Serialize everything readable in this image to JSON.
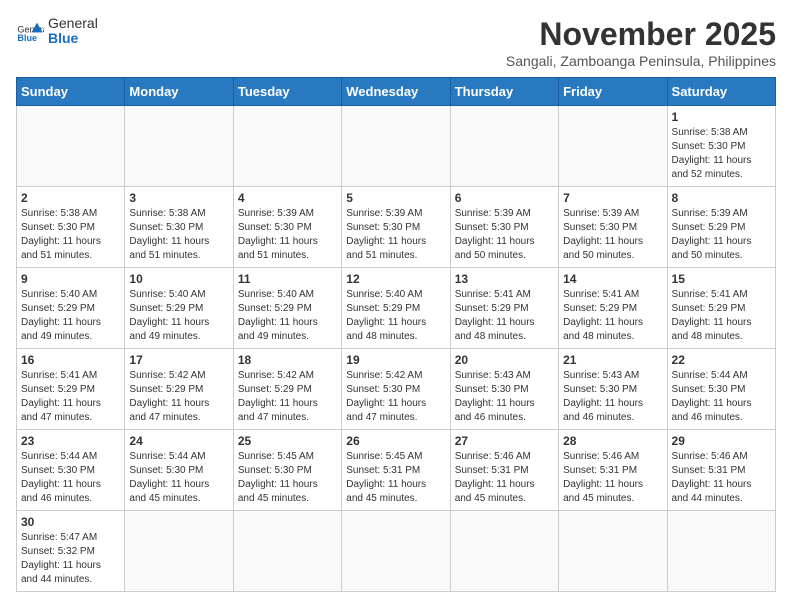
{
  "header": {
    "logo_general": "General",
    "logo_blue": "Blue",
    "month_title": "November 2025",
    "subtitle": "Sangali, Zamboanga Peninsula, Philippines"
  },
  "weekdays": [
    "Sunday",
    "Monday",
    "Tuesday",
    "Wednesday",
    "Thursday",
    "Friday",
    "Saturday"
  ],
  "weeks": [
    [
      {
        "day": "",
        "info": ""
      },
      {
        "day": "",
        "info": ""
      },
      {
        "day": "",
        "info": ""
      },
      {
        "day": "",
        "info": ""
      },
      {
        "day": "",
        "info": ""
      },
      {
        "day": "",
        "info": ""
      },
      {
        "day": "1",
        "info": "Sunrise: 5:38 AM\nSunset: 5:30 PM\nDaylight: 11 hours\nand 52 minutes."
      }
    ],
    [
      {
        "day": "2",
        "info": "Sunrise: 5:38 AM\nSunset: 5:30 PM\nDaylight: 11 hours\nand 51 minutes."
      },
      {
        "day": "3",
        "info": "Sunrise: 5:38 AM\nSunset: 5:30 PM\nDaylight: 11 hours\nand 51 minutes."
      },
      {
        "day": "4",
        "info": "Sunrise: 5:39 AM\nSunset: 5:30 PM\nDaylight: 11 hours\nand 51 minutes."
      },
      {
        "day": "5",
        "info": "Sunrise: 5:39 AM\nSunset: 5:30 PM\nDaylight: 11 hours\nand 51 minutes."
      },
      {
        "day": "6",
        "info": "Sunrise: 5:39 AM\nSunset: 5:30 PM\nDaylight: 11 hours\nand 50 minutes."
      },
      {
        "day": "7",
        "info": "Sunrise: 5:39 AM\nSunset: 5:30 PM\nDaylight: 11 hours\nand 50 minutes."
      },
      {
        "day": "8",
        "info": "Sunrise: 5:39 AM\nSunset: 5:29 PM\nDaylight: 11 hours\nand 50 minutes."
      }
    ],
    [
      {
        "day": "9",
        "info": "Sunrise: 5:40 AM\nSunset: 5:29 PM\nDaylight: 11 hours\nand 49 minutes."
      },
      {
        "day": "10",
        "info": "Sunrise: 5:40 AM\nSunset: 5:29 PM\nDaylight: 11 hours\nand 49 minutes."
      },
      {
        "day": "11",
        "info": "Sunrise: 5:40 AM\nSunset: 5:29 PM\nDaylight: 11 hours\nand 49 minutes."
      },
      {
        "day": "12",
        "info": "Sunrise: 5:40 AM\nSunset: 5:29 PM\nDaylight: 11 hours\nand 48 minutes."
      },
      {
        "day": "13",
        "info": "Sunrise: 5:41 AM\nSunset: 5:29 PM\nDaylight: 11 hours\nand 48 minutes."
      },
      {
        "day": "14",
        "info": "Sunrise: 5:41 AM\nSunset: 5:29 PM\nDaylight: 11 hours\nand 48 minutes."
      },
      {
        "day": "15",
        "info": "Sunrise: 5:41 AM\nSunset: 5:29 PM\nDaylight: 11 hours\nand 48 minutes."
      }
    ],
    [
      {
        "day": "16",
        "info": "Sunrise: 5:41 AM\nSunset: 5:29 PM\nDaylight: 11 hours\nand 47 minutes."
      },
      {
        "day": "17",
        "info": "Sunrise: 5:42 AM\nSunset: 5:29 PM\nDaylight: 11 hours\nand 47 minutes."
      },
      {
        "day": "18",
        "info": "Sunrise: 5:42 AM\nSunset: 5:29 PM\nDaylight: 11 hours\nand 47 minutes."
      },
      {
        "day": "19",
        "info": "Sunrise: 5:42 AM\nSunset: 5:30 PM\nDaylight: 11 hours\nand 47 minutes."
      },
      {
        "day": "20",
        "info": "Sunrise: 5:43 AM\nSunset: 5:30 PM\nDaylight: 11 hours\nand 46 minutes."
      },
      {
        "day": "21",
        "info": "Sunrise: 5:43 AM\nSunset: 5:30 PM\nDaylight: 11 hours\nand 46 minutes."
      },
      {
        "day": "22",
        "info": "Sunrise: 5:44 AM\nSunset: 5:30 PM\nDaylight: 11 hours\nand 46 minutes."
      }
    ],
    [
      {
        "day": "23",
        "info": "Sunrise: 5:44 AM\nSunset: 5:30 PM\nDaylight: 11 hours\nand 46 minutes."
      },
      {
        "day": "24",
        "info": "Sunrise: 5:44 AM\nSunset: 5:30 PM\nDaylight: 11 hours\nand 45 minutes."
      },
      {
        "day": "25",
        "info": "Sunrise: 5:45 AM\nSunset: 5:30 PM\nDaylight: 11 hours\nand 45 minutes."
      },
      {
        "day": "26",
        "info": "Sunrise: 5:45 AM\nSunset: 5:31 PM\nDaylight: 11 hours\nand 45 minutes."
      },
      {
        "day": "27",
        "info": "Sunrise: 5:46 AM\nSunset: 5:31 PM\nDaylight: 11 hours\nand 45 minutes."
      },
      {
        "day": "28",
        "info": "Sunrise: 5:46 AM\nSunset: 5:31 PM\nDaylight: 11 hours\nand 45 minutes."
      },
      {
        "day": "29",
        "info": "Sunrise: 5:46 AM\nSunset: 5:31 PM\nDaylight: 11 hours\nand 44 minutes."
      }
    ],
    [
      {
        "day": "30",
        "info": "Sunrise: 5:47 AM\nSunset: 5:32 PM\nDaylight: 11 hours\nand 44 minutes."
      },
      {
        "day": "",
        "info": ""
      },
      {
        "day": "",
        "info": ""
      },
      {
        "day": "",
        "info": ""
      },
      {
        "day": "",
        "info": ""
      },
      {
        "day": "",
        "info": ""
      },
      {
        "day": "",
        "info": ""
      }
    ]
  ]
}
